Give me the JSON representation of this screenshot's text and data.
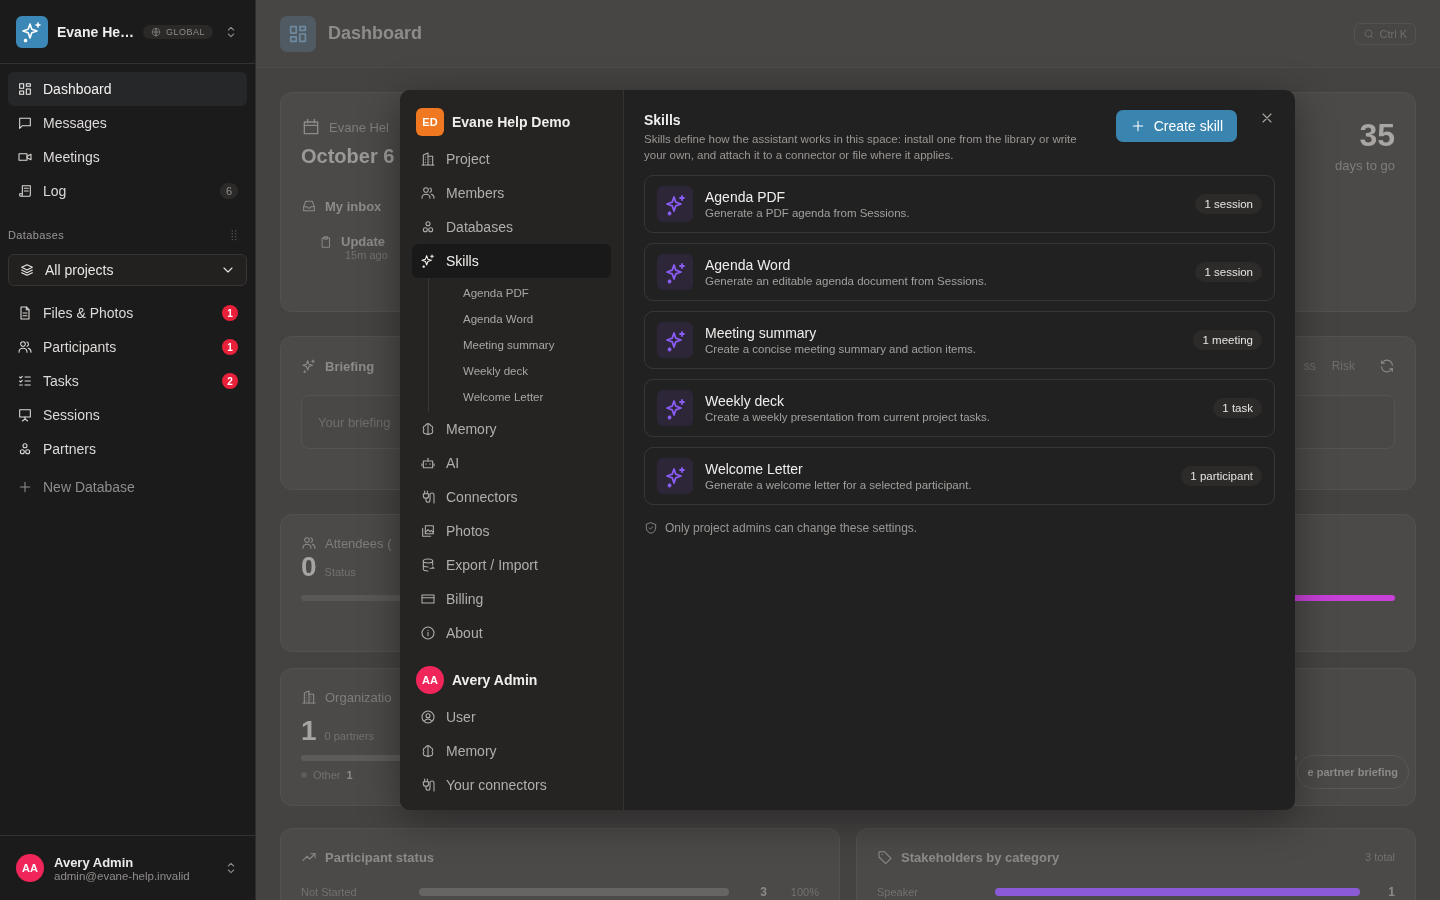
{
  "sidebar": {
    "workspace": {
      "name": "Evane He…",
      "badge": "GLOBAL"
    },
    "nav": [
      {
        "label": "Dashboard",
        "selected": true
      },
      {
        "label": "Messages",
        "selected": false
      },
      {
        "label": "Meetings",
        "selected": false
      },
      {
        "label": "Log",
        "selected": false,
        "count": "6"
      }
    ],
    "databases_heading": "Databases",
    "project_select": {
      "value": "All projects"
    },
    "databases": [
      {
        "label": "Files & Photos",
        "selected": false,
        "count": "1"
      },
      {
        "label": "Participants",
        "selected": false,
        "count": "1"
      },
      {
        "label": "Tasks",
        "selected": false,
        "count": "2"
      },
      {
        "label": "Sessions",
        "selected": false
      },
      {
        "label": "Partners",
        "selected": false
      }
    ],
    "new_database": "New Database",
    "user": {
      "initials": "AA",
      "name": "Avery Admin",
      "email": "admin@evane-help.invalid"
    }
  },
  "dashboard": {
    "title": "Dashboard",
    "search_shortcut": "Ctrl K",
    "overview": {
      "project": "Evane Hel",
      "date": "October 6",
      "inbox_title": "My inbox",
      "inbox_item": "Update",
      "inbox_time": "15m ago",
      "countdown": "35",
      "countdown_label": "days to go"
    },
    "briefing": {
      "title": "Briefing",
      "placeholder": "Your briefing",
      "tabs": [
        {
          "label": "ss",
          "selected": false
        },
        {
          "label": "Risk",
          "selected": false
        }
      ]
    },
    "attendees": {
      "title": "Attendees (",
      "count": "0",
      "status_label": "Status"
    },
    "organizations": {
      "title": "Organizatio",
      "count": "1",
      "count_label": "0 partners",
      "legend": [
        {
          "label": "Other",
          "value": "1"
        }
      ],
      "action": "e partner briefing"
    },
    "participant_status": {
      "title": "Participant status",
      "rows": [
        {
          "label": "Not Started",
          "level": 1,
          "count": "3",
          "percent": "100%"
        }
      ]
    },
    "stakeholders": {
      "title": "Stakeholders by category",
      "total": "3 total",
      "rows": [
        {
          "label": "Speaker",
          "level": 1,
          "count": "1"
        }
      ]
    }
  },
  "settings_dialog": {
    "project": {
      "initials": "ED",
      "name": "Evane Help Demo"
    },
    "nav": [
      {
        "label": "Project",
        "selected": false
      },
      {
        "label": "Members",
        "selected": false
      },
      {
        "label": "Databases",
        "selected": false
      },
      {
        "label": "Skills",
        "selected": true,
        "children": [
          {
            "label": "Agenda PDF",
            "selected": false
          },
          {
            "label": "Agenda Word",
            "selected": false
          },
          {
            "label": "Meeting summary",
            "selected": false
          },
          {
            "label": "Weekly deck",
            "selected": false
          },
          {
            "label": "Welcome Letter",
            "selected": false
          }
        ]
      },
      {
        "label": "Memory",
        "selected": false
      },
      {
        "label": "AI",
        "selected": false
      },
      {
        "label": "Connectors",
        "selected": false
      },
      {
        "label": "Photos",
        "selected": false
      },
      {
        "label": "Export / Import",
        "selected": false
      },
      {
        "label": "Billing",
        "selected": false
      },
      {
        "label": "About",
        "selected": false
      }
    ],
    "user": {
      "initials": "AA",
      "name": "Avery Admin"
    },
    "user_nav": [
      {
        "label": "User",
        "selected": false
      },
      {
        "label": "Memory",
        "selected": false
      },
      {
        "label": "Your connectors",
        "selected": false
      }
    ],
    "title": "Skills",
    "description": "Skills define how the assistant works in this space: install one from the library or write your own, and attach it to a connector or file where it applies.",
    "create_button": "Create skill",
    "skills": [
      {
        "name": "Agenda PDF",
        "description": "Generate a PDF agenda from Sessions.",
        "usage": "1 session"
      },
      {
        "name": "Agenda Word",
        "description": "Generate an editable agenda document from Sessions.",
        "usage": "1 session"
      },
      {
        "name": "Meeting summary",
        "description": "Create a concise meeting summary and action items.",
        "usage": "1 meeting"
      },
      {
        "name": "Weekly deck",
        "description": "Create a weekly presentation from current project tasks.",
        "usage": "1 task"
      },
      {
        "name": "Welcome Letter",
        "description": "Generate a welcome letter for a selected participant.",
        "usage": "1 participant"
      }
    ],
    "note": "Only project admins can change these settings."
  }
}
